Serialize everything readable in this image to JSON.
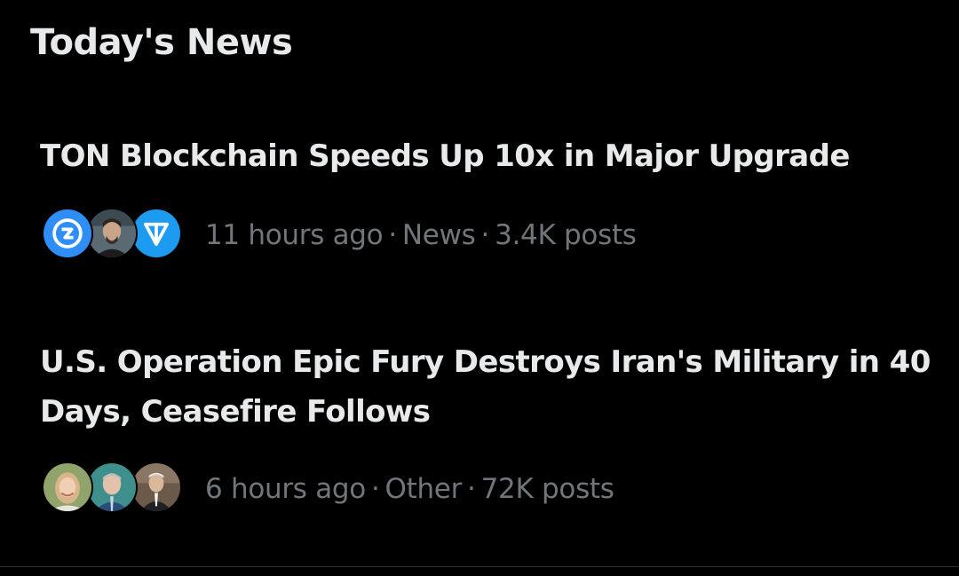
{
  "section": {
    "title": "Today's News"
  },
  "news": [
    {
      "headline": "TON Blockchain Speeds Up 10x in Major Upgrade",
      "time": "11 hours ago",
      "category": "News",
      "posts": "3.4K posts",
      "avatars": [
        "blue-logo-avatar",
        "man-portrait-avatar",
        "ton-logo-avatar"
      ]
    },
    {
      "headline": "U.S. Operation Epic Fury Destroys Iran's Military in 40 Days, Ceasefire Follows",
      "time": "6 hours ago",
      "category": "Other",
      "posts": "72K posts",
      "avatars": [
        "woman-portrait-avatar",
        "man-portrait-avatar",
        "man-suit-portrait-avatar"
      ]
    }
  ],
  "colors": {
    "background": "#000000",
    "primary_text": "#e7e9ea",
    "secondary_text": "#71767b",
    "accent_blue": "#1d9bf0"
  }
}
